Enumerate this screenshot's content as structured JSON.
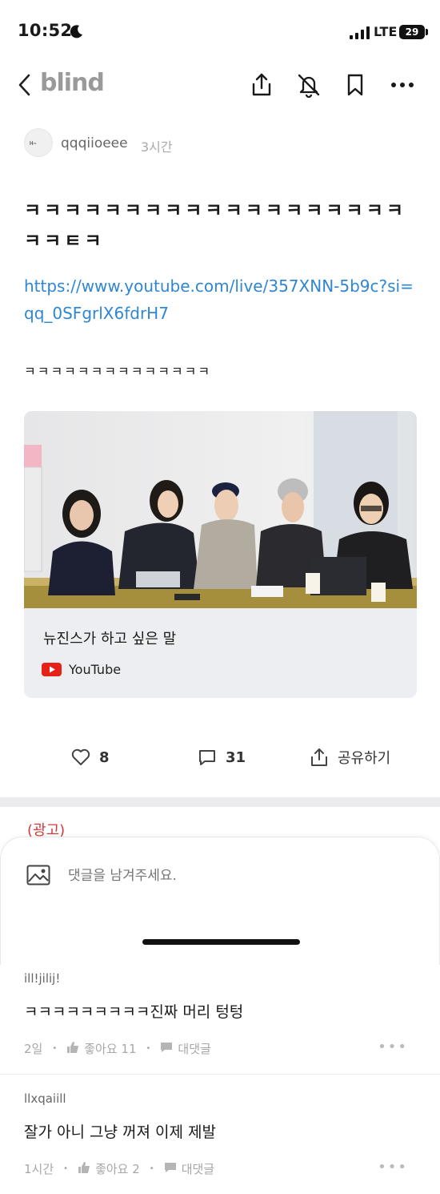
{
  "status_bar": {
    "time": "10:52",
    "network": "LTE",
    "battery": "29"
  },
  "nav": {
    "brand": "blind"
  },
  "post": {
    "author": "qqqiioeee",
    "time_ago": "3시간",
    "title": "ㅋㅋㅋㅋㅋㅋㅋㅋㅋㅋㅋㅋㅋㅋㅋㅋㅋㅋㅋㅋㅋㅌㅋ",
    "link": "https://www.youtube.com/live/357XNN-5b9c?si=qq_0SFgrlX6fdrH7",
    "body": "ㅋㅋㅋㅋㅋㅋㅋㅋㅋㅋㅋㅋㅋㅋ",
    "card": {
      "title": "뉴진스가 하고 싶은 말",
      "source": "YouTube"
    },
    "likes": "8",
    "comments": "31",
    "share_label": "공유하기"
  },
  "ad_label": "(광고)",
  "comment_box": {
    "placeholder": "댓글을 남겨주세요."
  },
  "comments": [
    {
      "user": "ill!jilij!",
      "text": "ㅋㅋㅋㅋㅋㅋㅋㅋㅋ진짜 머리 텅텅",
      "time": "2일",
      "likes": "좋아요 11",
      "reply": "대댓글"
    },
    {
      "user": "llxqaiill",
      "text": "잘가 아니 그냥 꺼져 이제 제발",
      "time": "1시간",
      "likes": "좋아요 2",
      "reply": "대댓글"
    }
  ],
  "colors": {
    "link": "#2f86d3",
    "ad": "#d43b3b",
    "youtube_red": "#e62117",
    "brand": "#9a9a9a"
  },
  "icons": [
    "back-icon",
    "share-icon",
    "bell-off-icon",
    "bookmark-icon",
    "more-icon",
    "heart-icon",
    "comment-icon",
    "share-icon",
    "image-icon",
    "thumbs-up-icon",
    "reply-icon",
    "youtube-icon"
  ]
}
